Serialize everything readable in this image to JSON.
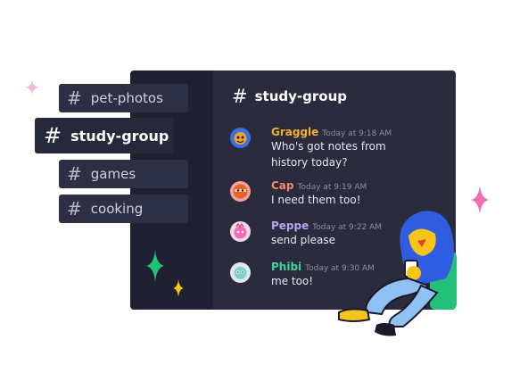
{
  "sidebar": {
    "channels": [
      {
        "label": "pet-photos"
      },
      {
        "label": "study-group"
      },
      {
        "label": "games"
      },
      {
        "label": "cooking"
      }
    ],
    "hash_symbol": "#"
  },
  "header": {
    "hash_symbol": "#",
    "title": "study-group"
  },
  "messages": [
    {
      "author": "Graggle",
      "time": "Today at 9:18 AM",
      "text_line1": "Who's got notes from",
      "text_line2": "history today?",
      "color": "#f0b232"
    },
    {
      "author": "Cap",
      "time": "Today at 9:19 AM",
      "text_line1": "I need them too!",
      "color": "#f28b6a"
    },
    {
      "author": "Peppe",
      "time": "Today at 9:22 AM",
      "text_line1": "send please",
      "color": "#b7a3f2"
    },
    {
      "author": "Phibi",
      "time": "Today at 9:30 AM",
      "text_line1": "me too!",
      "color": "#43d19e"
    }
  ],
  "colors": {
    "sparkle_green": "#23c07a",
    "sparkle_pink": "#f06bb0",
    "sparkle_yellow": "#f5c518",
    "character_blue": "#2f5ce0"
  }
}
